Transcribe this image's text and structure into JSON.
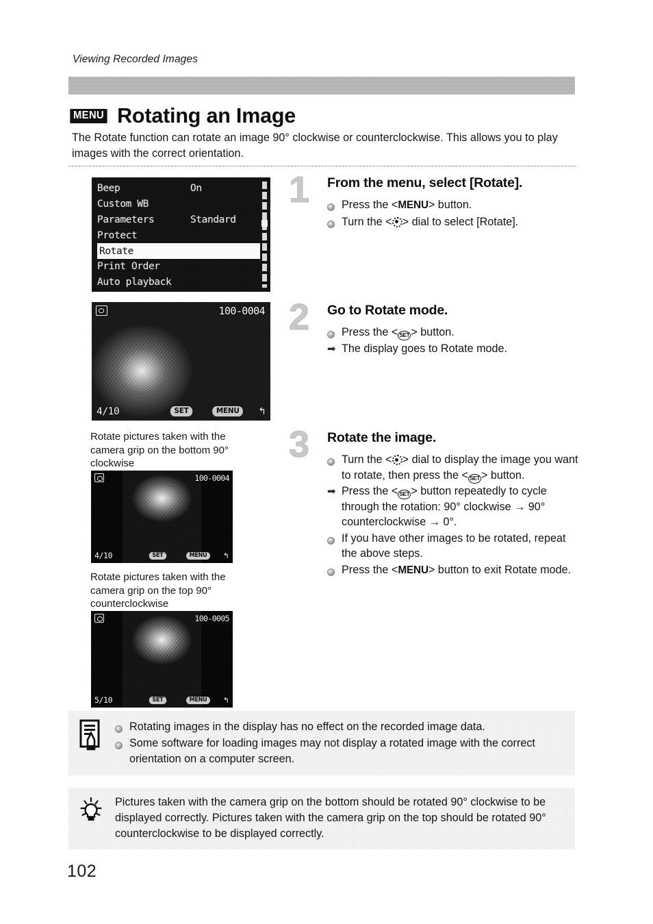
{
  "running_head": "Viewing Recorded Images",
  "title": {
    "menu_chip": "MENU",
    "text": "Rotating an Image"
  },
  "intro": "The Rotate function can rotate an image 90° clockwise or counterclockwise. This allows you to play images with the correct orientation.",
  "camera_menu": {
    "rows": [
      {
        "label": "Beep",
        "value": "On",
        "selected": false
      },
      {
        "label": "Custom WB",
        "value": "",
        "selected": false
      },
      {
        "label": "Parameters",
        "value": "Standard",
        "selected": false
      },
      {
        "label": "Protect",
        "value": "",
        "selected": false
      },
      {
        "label": "Rotate",
        "value": "",
        "selected": true
      },
      {
        "label": "Print Order",
        "value": "",
        "selected": false
      },
      {
        "label": "Auto playback",
        "value": "",
        "selected": false
      }
    ]
  },
  "screens": {
    "playback": {
      "file_number": "100-0004",
      "frame_count": "4/10",
      "set_label": "SET",
      "menu_label": "MENU",
      "return_glyph": "↰"
    },
    "rotated_bottom_grip": {
      "file_number": "100-0004",
      "frame_count": "4/10",
      "set_label": "SET",
      "menu_label": "MENU",
      "return_glyph": "↰"
    },
    "rotated_top_grip": {
      "file_number": "100-0005",
      "frame_count": "5/10",
      "set_label": "SET",
      "menu_label": "MENU",
      "return_glyph": "↰"
    }
  },
  "captions": {
    "bottom_grip": "Rotate pictures taken with the camera grip on the bottom 90° clockwise",
    "top_grip": "Rotate pictures taken with the camera grip on the top 90° counterclockwise"
  },
  "steps": [
    {
      "number": "1",
      "title": "From the menu, select [Rotate].",
      "lines": [
        {
          "mark": "dot",
          "text_before": "Press the <",
          "glyph": "MENU",
          "text_after": "> button."
        },
        {
          "mark": "dot",
          "text_before": "Turn the <",
          "glyph": "DIAL",
          "text_after": "> dial to select [Rotate]."
        }
      ]
    },
    {
      "number": "2",
      "title": "Go to Rotate mode.",
      "lines": [
        {
          "mark": "dot",
          "text_before": "Press the <",
          "glyph": "SET",
          "text_after": "> button."
        },
        {
          "mark": "arrow",
          "text_before": "The display goes to Rotate mode.",
          "glyph": "",
          "text_after": ""
        }
      ]
    },
    {
      "number": "3",
      "title": "Rotate the image.",
      "lines": [
        {
          "mark": "dot",
          "text_before": "Turn the <",
          "glyph": "DIAL",
          "text_after": "> dial to display the image you want to rotate, then press the <",
          "glyph2": "SET",
          "text_after2": "> button."
        },
        {
          "mark": "arrow",
          "text_before": "Press the <",
          "glyph": "SET",
          "text_after": "> button repeatedly to cycle through the rotation: 90° clockwise → 90° counterclockwise → 0°."
        },
        {
          "mark": "dot",
          "text_before": "If you have other images to be rotated, repeat the above steps.",
          "glyph": "",
          "text_after": ""
        },
        {
          "mark": "dot",
          "text_before": "Press the <",
          "glyph": "MENU",
          "text_after": "> button to exit Rotate mode."
        }
      ]
    }
  ],
  "notes": {
    "icon": "note-pencil-icon",
    "items": [
      "Rotating images in the display has no effect on the recorded image data.",
      "Some software for loading images may not display a rotated image with the correct orientation on a computer screen."
    ]
  },
  "tip": {
    "icon": "lightbulb-icon",
    "text": "Pictures taken with the camera grip on the bottom should be rotated 90° clockwise to be displayed correctly. Pictures taken with the camera grip on the top should be rotated 90° counterclockwise to be displayed correctly."
  },
  "page_number": "102",
  "colors": {
    "header_bar": "#a9a9a9",
    "note_bg": "#f4f4f4",
    "step_number": "#c8c8c8",
    "text": "#141414"
  }
}
